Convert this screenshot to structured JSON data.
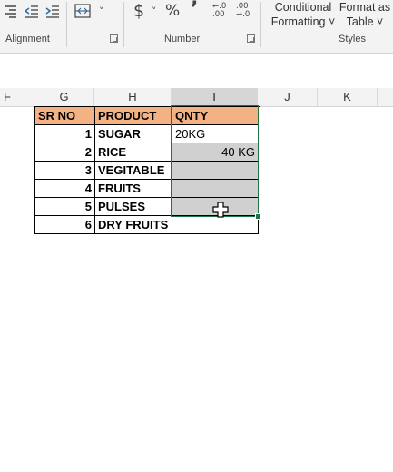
{
  "ribbon": {
    "alignment_label": "Alignment",
    "number_label": "Number",
    "styles_label": "Styles",
    "currency_symbol": "$",
    "percent_symbol": "%",
    "comma_symbol": "’",
    "increase_decimal_top": "←.0",
    "increase_decimal_bottom": ".00",
    "decrease_decimal_top": ".00",
    "decrease_decimal_bottom": "→.0",
    "conditional_line1": "Conditional",
    "conditional_line2": "Formatting ˅",
    "format_as_line1": "Format as",
    "format_as_line2": "Table ˅"
  },
  "columns": [
    "F",
    "G",
    "H",
    "I",
    "J",
    "K"
  ],
  "table": {
    "headers": [
      "SR NO",
      "PRODUCT",
      "QNTY"
    ],
    "rows": [
      {
        "sr": "1",
        "product": "SUGAR",
        "qnty": "20KG"
      },
      {
        "sr": "2",
        "product": "RICE",
        "qnty": "40 KG"
      },
      {
        "sr": "3",
        "product": "VEGITABLE",
        "qnty": ""
      },
      {
        "sr": "4",
        "product": "FRUITS",
        "qnty": ""
      },
      {
        "sr": "5",
        "product": "PULSES",
        "qnty": ""
      },
      {
        "sr": "6",
        "product": "DRY FRUITS",
        "qnty": ""
      }
    ]
  },
  "colors": {
    "header_fill": "#f4b183",
    "selection_fill": "#d0d0d0",
    "selection_border": "#217346"
  }
}
